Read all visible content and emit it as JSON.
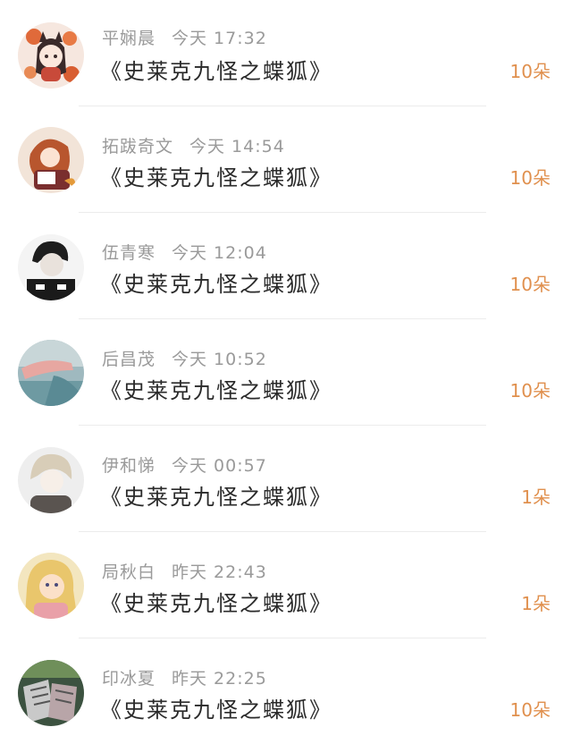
{
  "items": [
    {
      "name": "平娴晨",
      "time": "今天 17:32",
      "title": "《史莱克九怪之蝶狐》",
      "gift": "10朵",
      "avatar": "avatar-fox-girl-icon"
    },
    {
      "name": "拓跋奇文",
      "time": "今天 14:54",
      "title": "《史莱克九怪之蝶狐》",
      "gift": "10朵",
      "avatar": "avatar-reading-girl-icon"
    },
    {
      "name": "伍青寒",
      "time": "今天 12:04",
      "title": "《史莱克九怪之蝶狐》",
      "gift": "10朵",
      "avatar": "avatar-boy-portrait-icon"
    },
    {
      "name": "后昌茂",
      "time": "今天 10:52",
      "title": "《史莱克九怪之蝶狐》",
      "gift": "10朵",
      "avatar": "avatar-hand-photo-icon"
    },
    {
      "name": "伊和悌",
      "time": "今天 00:57",
      "title": "《史莱克九怪之蝶狐》",
      "gift": "1朵",
      "avatar": "avatar-pale-boy-icon"
    },
    {
      "name": "局秋白",
      "time": "昨天 22:43",
      "title": "《史莱克九怪之蝶狐》",
      "gift": "1朵",
      "avatar": "avatar-blonde-child-icon"
    },
    {
      "name": "印冰夏",
      "time": "昨天 22:25",
      "title": "《史莱克九怪之蝶狐》",
      "gift": "10朵",
      "avatar": "avatar-sneakers-icon"
    }
  ],
  "colors": {
    "gift": "#e0904e",
    "meta": "#9a9a9a",
    "title": "#2a2a2a",
    "divider": "#ececec"
  }
}
